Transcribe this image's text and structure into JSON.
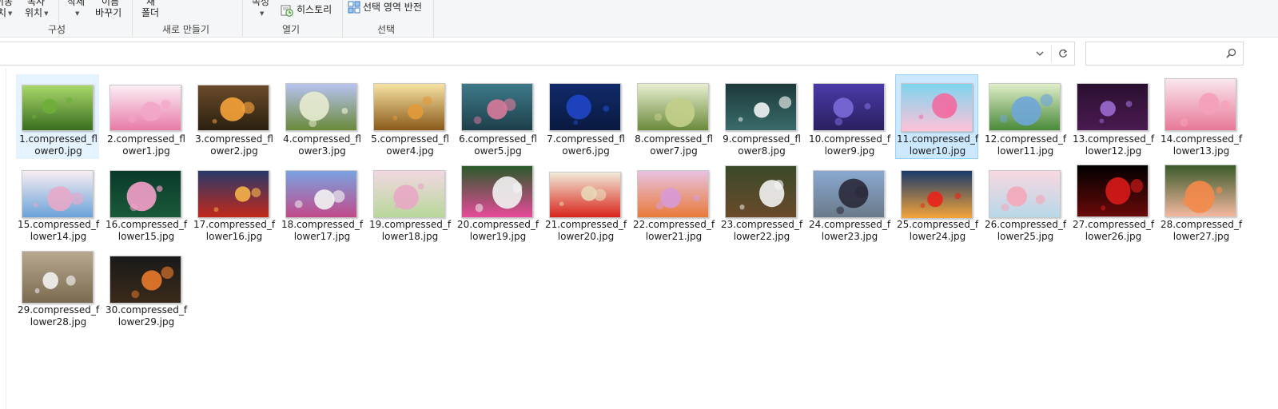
{
  "ribbon": {
    "organize_group": {
      "move_to_label_line2": "치",
      "move_to_label_line1": "이동",
      "copy_to_label_line1": "복사",
      "copy_to_label_line2": "위치",
      "delete_label": "삭제",
      "rename_label_line1": "이름",
      "rename_label_line2": "바꾸기",
      "group_label": "구성"
    },
    "new_group": {
      "new_folder_line1": "새",
      "new_folder_line2": "폴더",
      "group_label": "새로 만들기"
    },
    "open_group": {
      "properties_label": "속성",
      "history_label": "히스토리",
      "group_label": "열기"
    },
    "select_group": {
      "invert_selection_label": "선택 영역 반전",
      "group_label": "선택"
    }
  },
  "address_bar": {
    "path": "",
    "dropdown_icon": "chevron-down-icon",
    "refresh_icon": "refresh-icon"
  },
  "search": {
    "placeholder": "",
    "icon": "search-icon"
  },
  "files": [
    {
      "line1": "1.compressed_fl",
      "line2": "ower0.jpg",
      "state": "hover"
    },
    {
      "line1": "2.compressed_fl",
      "line2": "ower1.jpg"
    },
    {
      "line1": "3.compressed_fl",
      "line2": "ower2.jpg"
    },
    {
      "line1": "4.compressed_fl",
      "line2": "ower3.jpg"
    },
    {
      "line1": "5.compressed_fl",
      "line2": "ower4.jpg"
    },
    {
      "line1": "6.compressed_fl",
      "line2": "ower5.jpg"
    },
    {
      "line1": "7.compressed_fl",
      "line2": "ower6.jpg"
    },
    {
      "line1": "8.compressed_fl",
      "line2": "ower7.jpg"
    },
    {
      "line1": "9.compressed_fl",
      "line2": "ower8.jpg"
    },
    {
      "line1": "10.compressed_f",
      "line2": "lower9.jpg"
    },
    {
      "line1": "11.compressed_f",
      "line2": "lower10.jpg",
      "state": "selected"
    },
    {
      "line1": "12.compressed_f",
      "line2": "lower11.jpg"
    },
    {
      "line1": "13.compressed_f",
      "line2": "lower12.jpg"
    },
    {
      "line1": "14.compressed_f",
      "line2": "lower13.jpg"
    },
    {
      "line1": "15.compressed_f",
      "line2": "lower14.jpg"
    },
    {
      "line1": "16.compressed_f",
      "line2": "lower15.jpg"
    },
    {
      "line1": "17.compressed_f",
      "line2": "lower16.jpg"
    },
    {
      "line1": "18.compressed_f",
      "line2": "lower17.jpg"
    },
    {
      "line1": "19.compressed_f",
      "line2": "lower18.jpg"
    },
    {
      "line1": "20.compressed_f",
      "line2": "lower19.jpg"
    },
    {
      "line1": "21.compressed_f",
      "line2": "lower20.jpg"
    },
    {
      "line1": "22.compressed_f",
      "line2": "lower21.jpg"
    },
    {
      "line1": "23.compressed_f",
      "line2": "lower22.jpg"
    },
    {
      "line1": "24.compressed_f",
      "line2": "lower23.jpg"
    },
    {
      "line1": "25.compressed_f",
      "line2": "lower24.jpg"
    },
    {
      "line1": "26.compressed_f",
      "line2": "lower25.jpg"
    },
    {
      "line1": "27.compressed_f",
      "line2": "lower26.jpg"
    },
    {
      "line1": "28.compressed_f",
      "line2": "lower27.jpg"
    },
    {
      "line1": "29.compressed_f",
      "line2": "lower28.jpg"
    },
    {
      "line1": "30.compressed_f",
      "line2": "lower29.jpg"
    }
  ],
  "colors": {
    "selection_fill": "#cce8ff",
    "selection_border": "#99d1ff",
    "hover_fill": "#e5f3ff"
  }
}
